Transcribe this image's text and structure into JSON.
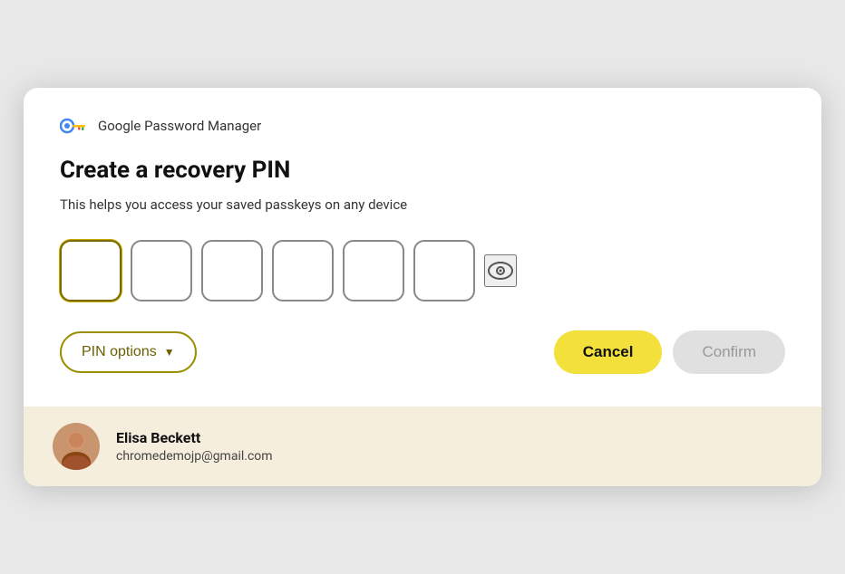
{
  "dialog": {
    "header": {
      "app_name": "Google Password Manager"
    },
    "title": "Create a recovery PIN",
    "subtitle": "This helps you access your saved passkeys on any device",
    "pin_fields": [
      {
        "id": "pin1",
        "value": ""
      },
      {
        "id": "pin2",
        "value": ""
      },
      {
        "id": "pin3",
        "value": ""
      },
      {
        "id": "pin4",
        "value": ""
      },
      {
        "id": "pin5",
        "value": ""
      },
      {
        "id": "pin6",
        "value": ""
      }
    ],
    "actions": {
      "pin_options_label": "PIN options",
      "cancel_label": "Cancel",
      "confirm_label": "Confirm"
    }
  },
  "footer": {
    "user_name": "Elisa Beckett",
    "user_email": "chromedemojp@gmail.com"
  },
  "icons": {
    "eye": "eye-icon",
    "chevron_down": "chevron-down-icon",
    "key": "key-icon"
  }
}
